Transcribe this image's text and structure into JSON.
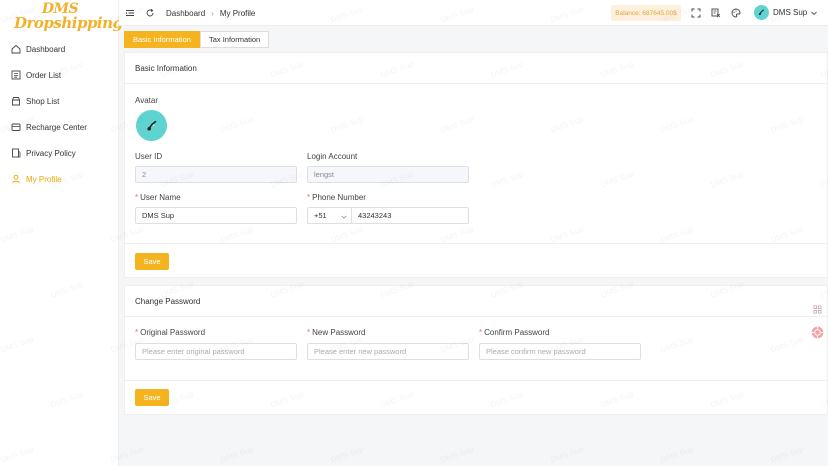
{
  "app": {
    "logo_line1": "DMS",
    "logo_line2": "Dropshipping",
    "watermark": "DMS Sup"
  },
  "sidebar": {
    "items": [
      {
        "label": "Dashboard",
        "icon": "home-icon",
        "active": false
      },
      {
        "label": "Order List",
        "icon": "list-icon",
        "active": false
      },
      {
        "label": "Shop List",
        "icon": "shop-icon",
        "active": false
      },
      {
        "label": "Recharge Center",
        "icon": "wallet-icon",
        "active": false
      },
      {
        "label": "Privacy Policy",
        "icon": "document-icon",
        "active": false
      },
      {
        "label": "My Profile",
        "icon": "user-icon",
        "active": true
      }
    ]
  },
  "header": {
    "breadcrumb": [
      "Dashboard",
      "My Profile"
    ],
    "balance": "Balance: 687645.00$",
    "user_name": "DMS Sup"
  },
  "tabs": [
    {
      "label": "Basic Information",
      "active": true
    },
    {
      "label": "Tax Information",
      "active": false
    }
  ],
  "basic": {
    "title": "Basic Information",
    "avatar_label": "Avatar",
    "user_id_label": "User ID",
    "user_id_value": "2",
    "login_account_label": "Login Account",
    "login_account_value": "lengst",
    "user_name_label": "User Name",
    "user_name_value": "DMS Sup",
    "phone_label": "Phone Number",
    "phone_prefix": "+51",
    "phone_value": "43243243",
    "save_label": "Save"
  },
  "password": {
    "title": "Change Password",
    "original_label": "Original Password",
    "original_placeholder": "Please enter original password",
    "new_label": "New Password",
    "new_placeholder": "Please enter new password",
    "confirm_label": "Confirm Password",
    "confirm_placeholder": "Please confirm new password",
    "save_label": "Save"
  },
  "colors": {
    "accent": "#f5b41f",
    "active_nav": "#f0a500",
    "avatar_bg": "#5fd3cf",
    "required": "#f56c6c"
  }
}
